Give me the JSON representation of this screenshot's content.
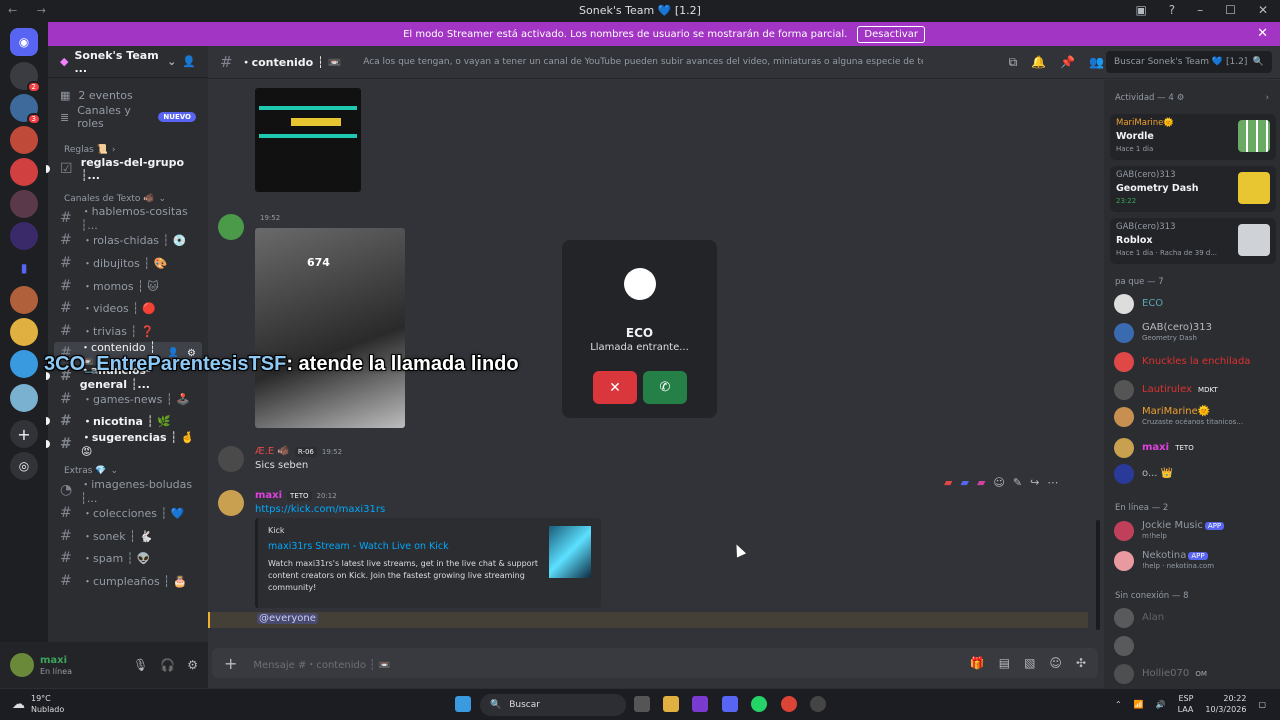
{
  "titlebar": {
    "title": "Sonek's Team 💙 [1.2]",
    "nav": "← →"
  },
  "banner": {
    "text": "El modo Streamer está activado. Los nombres de usuario se mostrarán de forma parcial.",
    "button": "Desactivar"
  },
  "server": {
    "name": "Sonek's Team ..."
  },
  "sidebar_top": [
    {
      "label": "2 eventos",
      "icon": "calendar-icon"
    },
    {
      "label": "Canales y roles",
      "badge": "NUEVO",
      "icon": "channels-icon"
    }
  ],
  "categories": {
    "reglas": "Reglas 📜",
    "texto": "Canales de Texto 🐗",
    "extras": "Extras 💎"
  },
  "channels": {
    "reglas": [
      {
        "label": "reglas-del-grupo ┆...",
        "unread": true
      }
    ],
    "texto": [
      {
        "label": "・hablemos-cositas ┆...",
        "unread": false
      },
      {
        "label": "・rolas-chidas ┆ 💿",
        "unread": false
      },
      {
        "label": "・dibujitos ┆ 🎨",
        "unread": false
      },
      {
        "label": "・momos ┆ 🐱",
        "unread": false
      },
      {
        "label": "・videos ┆ 🔴",
        "unread": false
      },
      {
        "label": "・trivias ┆ ❓",
        "unread": false
      },
      {
        "label": "・contenido ┆ 📼",
        "active": true
      },
      {
        "label": "・anuncios-general ┆...",
        "unread": true
      },
      {
        "label": "・games-news ┆ 🕹️",
        "unread": false
      },
      {
        "label": "・nicotina ┆ 🌿",
        "unread": true
      },
      {
        "label": "・sugerencias ┆ 🤞😡",
        "unread": true
      }
    ],
    "extras": [
      {
        "label": "・imagenes-boludas ┆...",
        "unread": false
      },
      {
        "label": "・colecciones ┆ 💙",
        "unread": false
      },
      {
        "label": "・sonek ┆ 🐇",
        "unread": false
      },
      {
        "label": "・spam ┆ 👽",
        "unread": false
      },
      {
        "label": "・cumpleaños ┆ 🎂",
        "unread": false
      }
    ]
  },
  "user": {
    "name": "maxi",
    "status": "En línea"
  },
  "channel_header": {
    "name": "・contenido ┆ 📼",
    "topic": "Aca los que tengan, o vayan a tener un canal de YouTube pueden subir avances del video, miniaturas o alguna especie de teaser."
  },
  "search": {
    "placeholder": "Buscar Sonek's Team 💙 [1.2]"
  },
  "messages": [
    {
      "author": "",
      "time": "19:52",
      "image_text": "674"
    },
    {
      "author": "Æ.E 🐗",
      "tag": "R-06",
      "time": "19:52",
      "text": "Sics seben"
    },
    {
      "author": "maxi",
      "tag": "TETO",
      "time": "20:12",
      "link": "https://kick.com/maxi31rs"
    }
  ],
  "embed": {
    "provider": "Kick",
    "title": "maxi31rs Stream - Watch Live on Kick",
    "description": "Watch maxi31rs's latest live streams, get in the live chat & support content creators on Kick. Join the fastest growing live streaming community!"
  },
  "mention": "@everyone",
  "composer": {
    "placeholder": "Mensaje #・contenido ┆ 📼"
  },
  "call": {
    "name": "ECO",
    "status": "Llamada entrante..."
  },
  "overlay": {
    "user": "3CO_EntreParentesisTSF",
    "text": ": atende la llamada lindo"
  },
  "members": {
    "activity_header": "Actividad — 4",
    "activities": [
      {
        "user": "MariMarine🌞",
        "game": "Wordle",
        "time": "Hace 1 día"
      },
      {
        "user": "GAB(cero)313",
        "game": "Geometry Dash",
        "time": "23:22"
      },
      {
        "user": "GAB(cero)313",
        "game": "Roblox",
        "time": "Hace 1 día · Racha de 39 d..."
      }
    ],
    "group1_header": "pa que — 7",
    "group1": [
      {
        "name": "ECO",
        "color": "#5aa7b5",
        "sub": ""
      },
      {
        "name": "GAB(cero)313",
        "color": "#b5bac1",
        "sub": "Geometry Dash"
      },
      {
        "name": "Knuckles la enchilada",
        "color": "#e03030",
        "sub": ""
      },
      {
        "name": "Lautirulex",
        "color": "#e03030",
        "sub": "",
        "tag": "MDKT"
      },
      {
        "name": "MariMarine🌞",
        "color": "#f0a030",
        "sub": "Cruzaste océanos titanicos..."
      },
      {
        "name": "maxi",
        "color": "#e040e0",
        "sub": "",
        "tag": "TETO"
      },
      {
        "name": "o... 👑",
        "color": "#b5bac1",
        "sub": ""
      }
    ],
    "group2_header": "En línea — 2",
    "group2": [
      {
        "name": "Jockie Music",
        "color": "#949ba4",
        "sub": "m!help",
        "app": "APP"
      },
      {
        "name": "Nekotina",
        "color": "#949ba4",
        "sub": "!help · nekotina.com",
        "app": "APP"
      }
    ],
    "group3_header": "Sin conexión — 8",
    "group3": [
      {
        "name": "Alan"
      },
      {
        "name": ""
      },
      {
        "name": "Hollie070",
        "tag": "OM"
      }
    ]
  },
  "taskbar": {
    "temp": "19°C",
    "weather": "Nublado",
    "search": "Buscar",
    "lang": "ESP",
    "lang2": "LAA",
    "time": "20:22",
    "date": "10/3/2026"
  }
}
